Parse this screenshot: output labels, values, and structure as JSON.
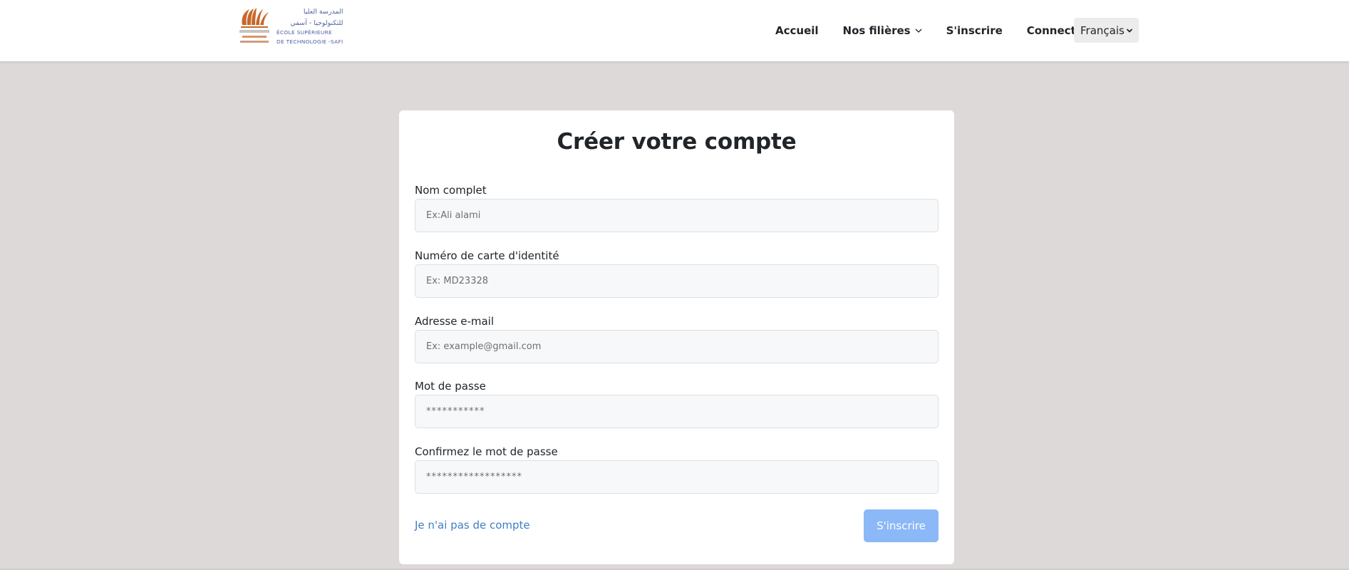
{
  "header": {
    "logo": {
      "arabic_line1": "المدرسة العليا",
      "arabic_line2": "للتكنولوجيا - آسفي",
      "french_line1": "ÉCOLE SUPÉRIEURE",
      "french_line2": "DE TECHNOLOGIE -SAFI"
    },
    "nav": {
      "home": "Accueil",
      "filieres": "Nos filières",
      "signup": "S'inscrire",
      "login": "Connecter"
    },
    "language": {
      "selected": "Français"
    }
  },
  "form": {
    "title": "Créer votre compte",
    "fields": [
      {
        "label": "Nom complet",
        "placeholder": "Ex:Ali alami",
        "value": ""
      },
      {
        "label": "Numéro de carte d'identité",
        "placeholder": "Ex: MD23328",
        "value": ""
      },
      {
        "label": "Adresse e-mail",
        "placeholder": "Ex: example@gmail.com",
        "value": ""
      },
      {
        "label": "Mot de passe",
        "placeholder": "***********",
        "value": ""
      },
      {
        "label": "Confirmez le mot de passe",
        "placeholder": "******************",
        "value": ""
      }
    ],
    "no_account_link": "Je n'ai pas de compte",
    "submit_label": "S'inscrire"
  },
  "colors": {
    "page_bg": "#dcd9d8",
    "link": "#3f7fc4",
    "button": "#8bb8f7",
    "logo_blue": "#5667a3",
    "logo_orange": "#c8682a"
  }
}
